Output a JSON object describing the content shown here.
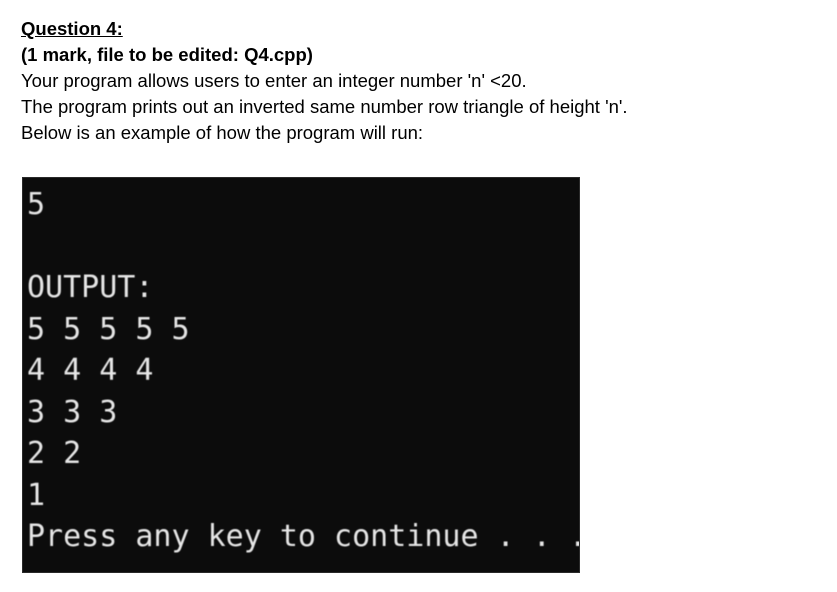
{
  "document": {
    "heading": "Question 4:",
    "subheading": "(1 mark, file to be edited: Q4.cpp)",
    "paragraphs": [
      "Your program allows users to enter an integer number 'n' <20.",
      "The program prints out an inverted same number row triangle of height 'n'.",
      "Below is an example of how the program will run:"
    ]
  },
  "console": {
    "background_color": "#0c0c0c",
    "text_color": "#e6e6e6",
    "lines": [
      "5",
      "",
      "OUTPUT:",
      "5 5 5 5 5",
      "4 4 4 4",
      "3 3 3",
      "2 2",
      "1",
      "Press any key to continue . . ."
    ]
  }
}
